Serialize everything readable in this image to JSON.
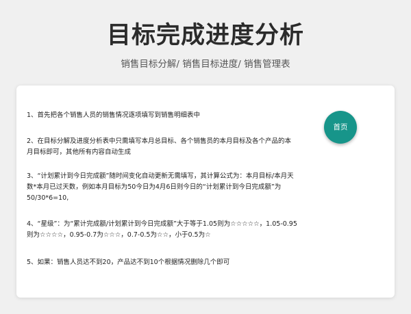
{
  "header": {
    "title": "目标完成进度分析",
    "subtitle": "销售目标分解/  销售目标进度/  销售管理表"
  },
  "instructions": [
    "1、首先把各个销售人员的销售情况逐项填写到销售明细表中",
    "2、在目标分解及进度分析表中只需填写本月总目标、各个销售员的本月目标及各个产品的本月目标即可，其他所有内容自动生成",
    "3、“计划累计到今日完成额”随时间变化自动更新无需填写，其计算公式为：本月目标/本月天数*本月已过天数，例如本月目标为50今日为4月6日则今日的“计划累计到今日完成额”为50/30*6=10,",
    "4、“星级”：为“累计完成额/计划累计到今日完成额”大于等于1.05则为☆☆☆☆☆，1.05-0.95则为☆☆☆☆，0.95-0.7为☆☆☆，0.7-0.5为☆☆，小于0.5为☆",
    "5、如果：销售人员达不到20，产品达不到10个根据情况删除几个即可"
  ],
  "home_button": {
    "label": "首页"
  },
  "colors": {
    "accent": "#17958a",
    "background": "#f0f0f0",
    "card": "#ffffff"
  }
}
